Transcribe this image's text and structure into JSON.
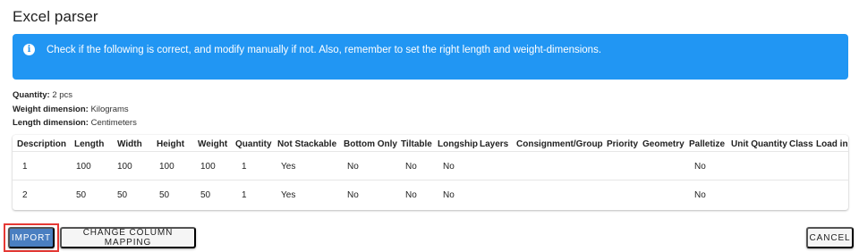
{
  "dialog": {
    "title": "Excel parser"
  },
  "alert": {
    "icon": "info-icon",
    "message": "Check if the following is correct, and modify manually if not. Also, remember to set the right length and weight-dimensions.",
    "color": "#2196f3"
  },
  "summary": {
    "quantity_label": "Quantity:",
    "quantity_value": "2 pcs",
    "weight_label": "Weight dimension:",
    "weight_value": "Kilograms",
    "length_label": "Length dimension:",
    "length_value": "Centimeters"
  },
  "table": {
    "columns": [
      "Description",
      "Length",
      "Width",
      "Height",
      "Weight",
      "Quantity",
      "Not Stackable",
      "Bottom Only",
      "Tiltable",
      "Longship",
      "Layers",
      "Consignment/Group",
      "Priority",
      "Geometry",
      "Palletize",
      "Unit Quantity",
      "Class",
      "Load in"
    ],
    "rows": [
      [
        "1",
        "100",
        "100",
        "100",
        "100",
        "1",
        "Yes",
        "No",
        "No",
        "No",
        "",
        "",
        "",
        "",
        "No",
        "",
        "",
        ""
      ],
      [
        "2",
        "50",
        "50",
        "50",
        "50",
        "1",
        "Yes",
        "No",
        "No",
        "No",
        "",
        "",
        "",
        "",
        "No",
        "",
        "",
        ""
      ]
    ]
  },
  "actions": {
    "import_label": "Import",
    "mapping_label": "Change column mapping",
    "cancel_label": "Cancel",
    "primary_color": "#4a7fc1",
    "highlight_color": "#e53935"
  }
}
